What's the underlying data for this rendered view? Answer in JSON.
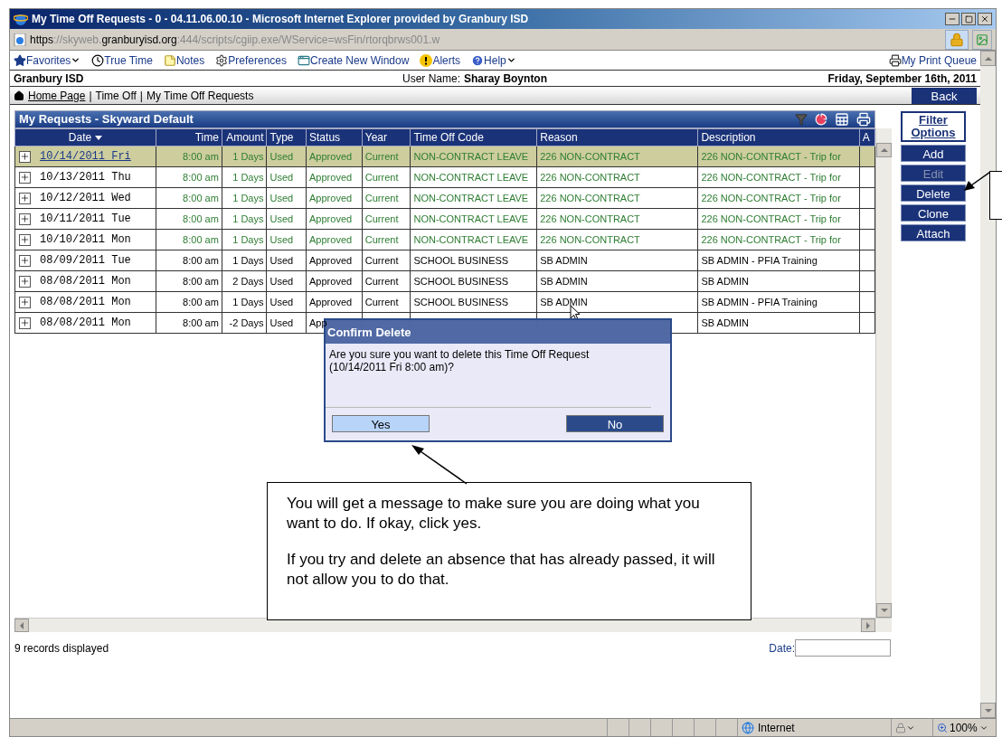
{
  "window": {
    "title": "My Time Off Requests - 0 - 04.11.06.00.10 - Microsoft Internet Explorer provided by Granbury ISD"
  },
  "address_bar": {
    "scheme": "https://skyweb.",
    "domain": "granburyisd.org",
    "path": ":444/scripts/cgiip.exe/WService=wsFin/rtorqbrws001.w"
  },
  "toolbar": [
    {
      "label": "Favorites",
      "kind": "favorites",
      "dropdown": true
    },
    {
      "label": "True Time",
      "kind": "clock",
      "dropdown": false
    },
    {
      "label": "Notes",
      "kind": "notes",
      "dropdown": false
    },
    {
      "label": "Preferences",
      "kind": "preferences",
      "dropdown": false
    },
    {
      "label": "Create New Window",
      "kind": "window",
      "dropdown": false
    },
    {
      "label": "Alerts",
      "kind": "alerts",
      "dropdown": false
    },
    {
      "label": "Help",
      "kind": "help",
      "dropdown": true
    }
  ],
  "print_queue": "My Print Queue",
  "header": {
    "district": "Granbury ISD",
    "user_label": "User Name:",
    "user_name": "Sharay Boynton",
    "date": "Friday, September 16th, 2011"
  },
  "breadcrumb": [
    {
      "label": "Home Page",
      "kind": "link"
    },
    {
      "label": "|",
      "kind": "separator"
    },
    {
      "label": "Time Off",
      "kind": "text"
    },
    {
      "label": "|",
      "kind": "separator"
    },
    {
      "label": "My Time Off Requests",
      "kind": "text"
    }
  ],
  "back_button": "Back",
  "grid": {
    "title": "My Requests - Skyward Default",
    "columns": [
      {
        "label": "Date",
        "sorted": true
      },
      {
        "label": "Time",
        "sorted": false
      },
      {
        "label": "Amount",
        "sorted": false
      },
      {
        "label": "Type",
        "sorted": false
      },
      {
        "label": "Status",
        "sorted": false
      },
      {
        "label": "Year",
        "sorted": false
      },
      {
        "label": "Time Off Code",
        "sorted": false
      },
      {
        "label": "Reason",
        "sorted": false
      },
      {
        "label": "Description",
        "sorted": false
      },
      {
        "label": "A",
        "sorted": false
      }
    ],
    "rows": [
      {
        "selected": true,
        "color": "#2e7d32",
        "cells": [
          "10/14/2011 Fri",
          "8:00 am",
          "1 Days",
          "Used",
          "Approved",
          "Current",
          "NON-CONTRACT LEAVE",
          "226 NON-CONTRACT",
          "226 NON-CONTRACT - Trip for"
        ]
      },
      {
        "selected": false,
        "color": "#2e7d32",
        "cells": [
          "10/13/2011 Thu",
          "8:00 am",
          "1 Days",
          "Used",
          "Approved",
          "Current",
          "NON-CONTRACT LEAVE",
          "226 NON-CONTRACT",
          "226 NON-CONTRACT - Trip for"
        ]
      },
      {
        "selected": false,
        "color": "#2e7d32",
        "cells": [
          "10/12/2011 Wed",
          "8:00 am",
          "1 Days",
          "Used",
          "Approved",
          "Current",
          "NON-CONTRACT LEAVE",
          "226 NON-CONTRACT",
          "226 NON-CONTRACT - Trip for"
        ]
      },
      {
        "selected": false,
        "color": "#2e7d32",
        "cells": [
          "10/11/2011 Tue",
          "8:00 am",
          "1 Days",
          "Used",
          "Approved",
          "Current",
          "NON-CONTRACT LEAVE",
          "226 NON-CONTRACT",
          "226 NON-CONTRACT - Trip for"
        ]
      },
      {
        "selected": false,
        "color": "#2e7d32",
        "cells": [
          "10/10/2011 Mon",
          "8:00 am",
          "1 Days",
          "Used",
          "Approved",
          "Current",
          "NON-CONTRACT LEAVE",
          "226 NON-CONTRACT",
          "226 NON-CONTRACT - Trip for"
        ]
      },
      {
        "selected": false,
        "color": "#000000",
        "cells": [
          "08/09/2011 Tue",
          "8:00 am",
          "1 Days",
          "Used",
          "Approved",
          "Current",
          "SCHOOL BUSINESS",
          "SB ADMIN",
          "SB ADMIN - PFIA Training"
        ]
      },
      {
        "selected": false,
        "color": "#000000",
        "cells": [
          "08/08/2011 Mon",
          "8:00 am",
          "2 Days",
          "Used",
          "Approved",
          "Current",
          "SCHOOL BUSINESS",
          "SB ADMIN",
          "SB ADMIN"
        ]
      },
      {
        "selected": false,
        "color": "#000000",
        "cells": [
          "08/08/2011 Mon",
          "8:00 am",
          "1 Days",
          "Used",
          "Approved",
          "Current",
          "SCHOOL BUSINESS",
          "SB ADMIN",
          "SB ADMIN - PFIA Training"
        ]
      },
      {
        "selected": false,
        "color": "#000000",
        "cells": [
          "08/08/2011 Mon",
          "8:00 am",
          "-2 Days",
          "Used",
          "App",
          "",
          "",
          "",
          "SB ADMIN"
        ]
      }
    ]
  },
  "side_buttons": [
    {
      "label": "Filter Options",
      "kind": "outline",
      "disabled": false
    },
    {
      "label": "Add",
      "kind": "solid",
      "disabled": false
    },
    {
      "label": "Edit",
      "kind": "solid",
      "disabled": true
    },
    {
      "label": "Delete",
      "kind": "solid",
      "disabled": false
    },
    {
      "label": "Clone",
      "kind": "solid",
      "disabled": false
    },
    {
      "label": "Attach",
      "kind": "solid",
      "disabled": false
    }
  ],
  "dialog": {
    "title": "Confirm Delete",
    "message": "Are you sure you want to delete this Time Off Request (10/14/2011 Fri 8:00 am)?",
    "buttons": [
      {
        "label": "Yes",
        "selected": true
      },
      {
        "label": "No",
        "selected": false
      }
    ]
  },
  "callout": {
    "paragraphs": [
      "You will get a message to make sure you are doing what you want to do.  If okay, click yes.",
      "If you try and delete an absence that has already passed, it will not allow you to do that."
    ]
  },
  "footer": {
    "records": "9 records displayed",
    "date_label": "Date:"
  },
  "status_bar": {
    "zone": "Internet",
    "zoom": "100%"
  }
}
